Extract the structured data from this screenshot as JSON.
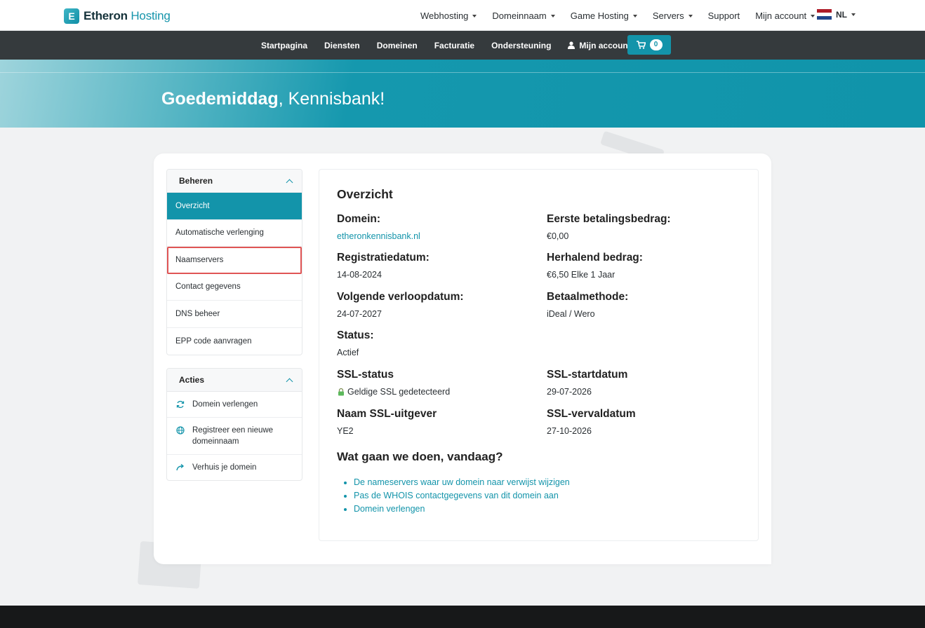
{
  "brand": {
    "name_bold": "Etheron",
    "name_light": "Hosting",
    "mark": "E"
  },
  "topnav": {
    "items": [
      {
        "label": "Webhosting",
        "dropdown": true
      },
      {
        "label": "Domeinnaam",
        "dropdown": true
      },
      {
        "label": "Game Hosting",
        "dropdown": true
      },
      {
        "label": "Servers",
        "dropdown": true
      },
      {
        "label": "Support",
        "dropdown": false
      },
      {
        "label": "Mijn account",
        "dropdown": true
      }
    ],
    "language": "NL"
  },
  "subnav": {
    "items": [
      "Startpagina",
      "Diensten",
      "Domeinen",
      "Facturatie",
      "Ondersteuning"
    ],
    "account_label": "Mijn account",
    "cart_count": "0"
  },
  "hero": {
    "greeting": "Goedemiddag",
    "name": ", Kennisbank!"
  },
  "sidebar": {
    "manage": {
      "title": "Beheren",
      "items": [
        "Overzicht",
        "Automatische verlenging",
        "Naamservers",
        "Contact gegevens",
        "DNS beheer",
        "EPP code aanvragen"
      ],
      "active_index": 0,
      "highlighted_index": 2
    },
    "actions": {
      "title": "Acties",
      "items": [
        {
          "label": "Domein verlengen",
          "icon": "refresh-icon"
        },
        {
          "label": "Registreer een nieuwe domeinnaam",
          "icon": "globe-icon"
        },
        {
          "label": "Verhuis je domein",
          "icon": "share-arrow-icon"
        }
      ]
    }
  },
  "overview": {
    "title": "Overzicht",
    "domain": {
      "label": "Domein:",
      "value": "etheronkennisbank.nl"
    },
    "first_payment": {
      "label": "Eerste betalingsbedrag:",
      "value": "€0,00"
    },
    "registration": {
      "label": "Registratiedatum:",
      "value": "14-08-2024"
    },
    "recurring": {
      "label": "Herhalend bedrag:",
      "value": "€6,50 Elke 1 Jaar"
    },
    "next_due": {
      "label": "Volgende verloopdatum:",
      "value": "24-07-2027"
    },
    "payment_method": {
      "label": "Betaalmethode:",
      "value": "iDeal / Wero"
    },
    "status": {
      "label": "Status:",
      "value": "Actief"
    },
    "ssl_status": {
      "label": "SSL-status",
      "value": "Geldige SSL gedetecteerd"
    },
    "ssl_start": {
      "label": "SSL-startdatum",
      "value": "29-07-2026"
    },
    "ssl_issuer": {
      "label": "Naam SSL-uitgever",
      "value": "YE2"
    },
    "ssl_expiry": {
      "label": "SSL-vervaldatum",
      "value": "27-10-2026"
    },
    "todo": {
      "title": "Wat gaan we doen, vandaag?",
      "links": [
        "De nameservers waar uw domein naar verwijst wijzigen",
        "Pas de WHOIS contactgegevens van dit domein aan",
        "Domein verlengen"
      ]
    }
  },
  "colors": {
    "accent": "#1394aa",
    "dark_nav": "#353a3d",
    "highlight": "#e05555"
  }
}
